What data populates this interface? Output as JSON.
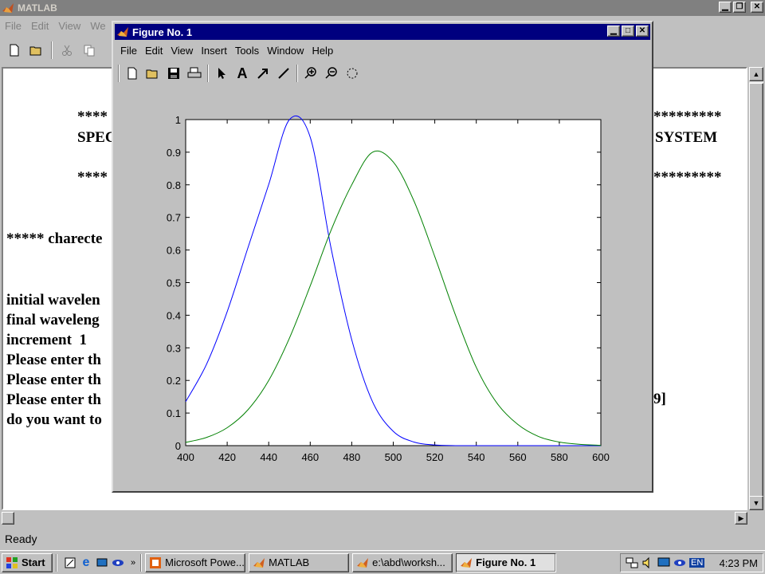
{
  "matlab": {
    "title": "MATLAB",
    "menu": [
      "File",
      "Edit",
      "View",
      "We"
    ],
    "status": "Ready"
  },
  "command_window": {
    "lines": [
      "****",
      "SPEC",
      "****",
      "***** charecte",
      "initial wavelen",
      "final waveleng",
      "increment  1",
      "Please enter th",
      "Please enter th",
      "Please enter th",
      "do you want to"
    ],
    "right_fragments": [
      "*********",
      "SYSTEM",
      "*********",
      "9]"
    ]
  },
  "figure": {
    "title": "Figure No. 1",
    "menu": [
      "File",
      "Edit",
      "View",
      "Insert",
      "Tools",
      "Window",
      "Help"
    ],
    "toolbar_icons": [
      "new-icon",
      "open-icon",
      "save-icon",
      "print-icon",
      "arrow-icon",
      "text-icon",
      "draw-arrow-icon",
      "line-icon",
      "zoom-in-icon",
      "zoom-out-icon",
      "rotate-icon"
    ]
  },
  "chart_data": {
    "type": "line",
    "xlim": [
      400,
      600
    ],
    "ylim": [
      0,
      1
    ],
    "x_ticks": [
      "400",
      "420",
      "440",
      "460",
      "480",
      "500",
      "520",
      "540",
      "560",
      "580",
      "600"
    ],
    "y_ticks": [
      "0",
      "0.1",
      "0.2",
      "0.3",
      "0.4",
      "0.5",
      "0.6",
      "0.7",
      "0.8",
      "0.9",
      "1"
    ],
    "grid": false,
    "series": [
      {
        "color": "#0000ff",
        "x": [
          400,
          410,
          420,
          430,
          440,
          450,
          460,
          470,
          480,
          490,
          500,
          510,
          520,
          530,
          540,
          550,
          560,
          570,
          580,
          590,
          600
        ],
        "y": [
          0.135,
          0.249,
          0.411,
          0.607,
          0.801,
          1.0,
          0.946,
          0.607,
          0.325,
          0.135,
          0.044,
          0.011,
          0.002,
          0.0,
          0.0,
          0.0,
          0.0,
          0.0,
          0.0,
          0.0,
          0.0
        ]
      },
      {
        "color": "#008000",
        "x": [
          400,
          410,
          420,
          430,
          440,
          450,
          460,
          470,
          480,
          490,
          500,
          510,
          520,
          530,
          540,
          550,
          560,
          570,
          580,
          590,
          600
        ],
        "y": [
          0.01,
          0.025,
          0.055,
          0.11,
          0.2,
          0.33,
          0.49,
          0.66,
          0.8,
          0.9,
          0.87,
          0.75,
          0.58,
          0.4,
          0.24,
          0.13,
          0.065,
          0.028,
          0.011,
          0.004,
          0.001
        ]
      }
    ]
  },
  "taskbar": {
    "start": "Start",
    "tasks": [
      {
        "label": "Microsoft Powe...",
        "active": false
      },
      {
        "label": "MATLAB",
        "active": false
      },
      {
        "label": "e:\\abd\\worksh...",
        "active": false
      },
      {
        "label": "Figure No. 1",
        "active": true
      }
    ],
    "tray_lang": "EN",
    "clock": "4:23 PM"
  }
}
